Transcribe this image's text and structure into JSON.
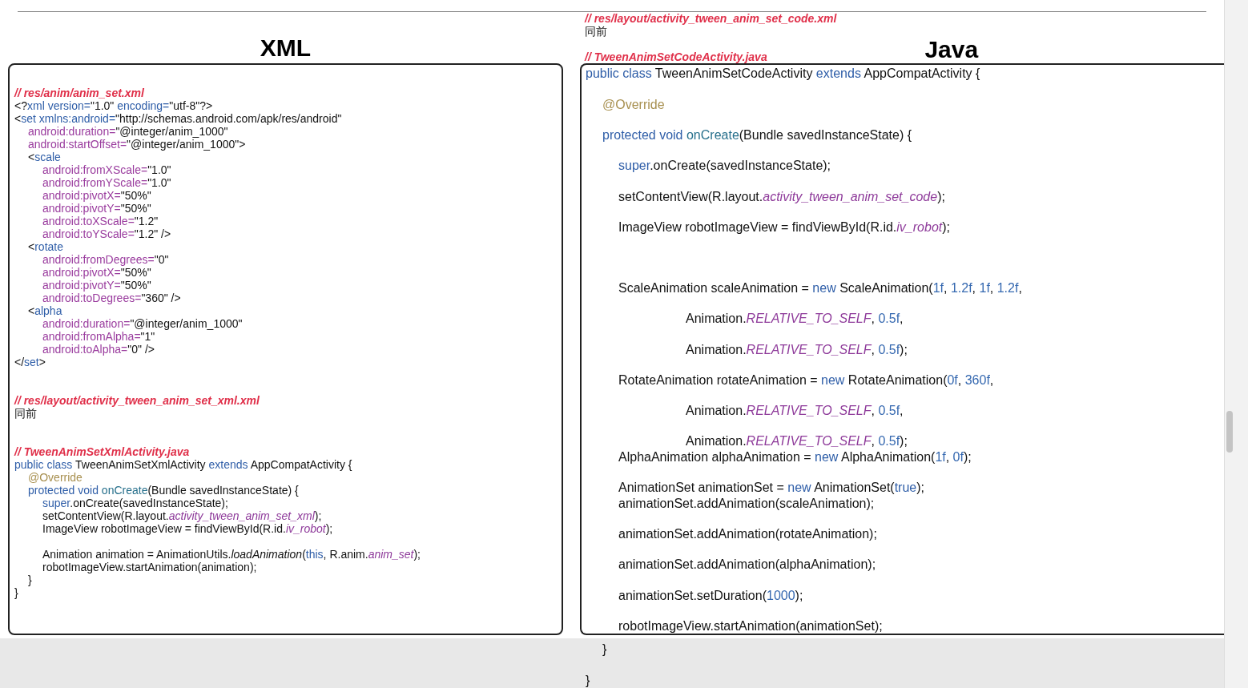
{
  "top_notes": [
    {
      "kind": "code",
      "segs": [
        {
          "kind": "cm",
          "text": "// res/layout/activity_tween_anim_set_code.xml"
        }
      ]
    },
    {
      "kind": "code",
      "segs": [
        {
          "kind": "p",
          "text": "同前"
        }
      ]
    },
    {
      "kind": "blank"
    },
    {
      "kind": "code",
      "segs": [
        {
          "kind": "cm",
          "text": "// TweenAnimSetCodeActivity.java"
        }
      ]
    }
  ],
  "panels": [
    {
      "heading": "XML",
      "kind": "dense",
      "lines": [
        {
          "kind": "code",
          "segs": [
            {
              "kind": "cm",
              "text": "// res/anim/anim_set.xml"
            }
          ]
        },
        {
          "kind": "code",
          "segs": [
            {
              "kind": "p",
              "text": "<?"
            },
            {
              "kind": "tag",
              "text": "xml version="
            },
            {
              "kind": "p",
              "text": "\"1.0\" "
            },
            {
              "kind": "tag",
              "text": "encoding="
            },
            {
              "kind": "p",
              "text": "\"utf-8\"?>"
            }
          ]
        },
        {
          "kind": "code",
          "segs": [
            {
              "kind": "p",
              "text": "<"
            },
            {
              "kind": "tag",
              "text": "set xmlns:android="
            },
            {
              "kind": "p",
              "text": "\"http://schemas.android.com/apk/res/android\""
            }
          ],
          "children": [
            {
              "kind": "code",
              "segs": [
                {
                  "kind": "attr",
                  "text": "android:duration="
                },
                {
                  "kind": "p",
                  "text": "\"@integer/anim_1000\""
                }
              ]
            },
            {
              "kind": "code",
              "segs": [
                {
                  "kind": "attr",
                  "text": "android:startOffset="
                },
                {
                  "kind": "p",
                  "text": "\"@integer/anim_1000\">"
                }
              ]
            },
            {
              "kind": "code",
              "segs": [
                {
                  "kind": "p",
                  "text": "<"
                },
                {
                  "kind": "tag",
                  "text": "scale"
                }
              ],
              "children": [
                {
                  "kind": "code",
                  "segs": [
                    {
                      "kind": "attr",
                      "text": "android:fromXScale="
                    },
                    {
                      "kind": "p",
                      "text": "\"1.0\""
                    }
                  ]
                },
                {
                  "kind": "code",
                  "segs": [
                    {
                      "kind": "attr",
                      "text": "android:fromYScale="
                    },
                    {
                      "kind": "p",
                      "text": "\"1.0\""
                    }
                  ]
                },
                {
                  "kind": "code",
                  "segs": [
                    {
                      "kind": "attr",
                      "text": "android:pivotX="
                    },
                    {
                      "kind": "p",
                      "text": "\"50%\""
                    }
                  ]
                },
                {
                  "kind": "code",
                  "segs": [
                    {
                      "kind": "attr",
                      "text": "android:pivotY="
                    },
                    {
                      "kind": "p",
                      "text": "\"50%\""
                    }
                  ]
                },
                {
                  "kind": "code",
                  "segs": [
                    {
                      "kind": "attr",
                      "text": "android:toXScale="
                    },
                    {
                      "kind": "p",
                      "text": "\"1.2\""
                    }
                  ]
                },
                {
                  "kind": "code",
                  "segs": [
                    {
                      "kind": "attr",
                      "text": "android:toYScale="
                    },
                    {
                      "kind": "p",
                      "text": "\"1.2\" />"
                    }
                  ]
                }
              ]
            },
            {
              "kind": "code",
              "segs": [
                {
                  "kind": "p",
                  "text": "<"
                },
                {
                  "kind": "tag",
                  "text": "rotate"
                }
              ],
              "children": [
                {
                  "kind": "code",
                  "segs": [
                    {
                      "kind": "attr",
                      "text": "android:fromDegrees="
                    },
                    {
                      "kind": "p",
                      "text": "\"0\""
                    }
                  ]
                },
                {
                  "kind": "code",
                  "segs": [
                    {
                      "kind": "attr",
                      "text": "android:pivotX="
                    },
                    {
                      "kind": "p",
                      "text": "\"50%\""
                    }
                  ]
                },
                {
                  "kind": "code",
                  "segs": [
                    {
                      "kind": "attr",
                      "text": "android:pivotY="
                    },
                    {
                      "kind": "p",
                      "text": "\"50%\""
                    }
                  ]
                },
                {
                  "kind": "code",
                  "segs": [
                    {
                      "kind": "attr",
                      "text": "android:toDegrees="
                    },
                    {
                      "kind": "p",
                      "text": "\"360\" />"
                    }
                  ]
                }
              ]
            },
            {
              "kind": "code",
              "segs": [
                {
                  "kind": "p",
                  "text": "<"
                },
                {
                  "kind": "tag",
                  "text": "alpha"
                }
              ],
              "children": [
                {
                  "kind": "code",
                  "segs": [
                    {
                      "kind": "attr",
                      "text": "android:duration="
                    },
                    {
                      "kind": "p",
                      "text": "\"@integer/anim_1000\""
                    }
                  ]
                },
                {
                  "kind": "code",
                  "segs": [
                    {
                      "kind": "attr",
                      "text": "android:fromAlpha="
                    },
                    {
                      "kind": "p",
                      "text": "\"1\""
                    }
                  ]
                },
                {
                  "kind": "code",
                  "segs": [
                    {
                      "kind": "attr",
                      "text": "android:toAlpha="
                    },
                    {
                      "kind": "p",
                      "text": "\"0\" />"
                    }
                  ]
                }
              ]
            }
          ]
        },
        {
          "kind": "code",
          "segs": [
            {
              "kind": "p",
              "text": "</"
            },
            {
              "kind": "tag",
              "text": "set"
            },
            {
              "kind": "p",
              "text": ">"
            }
          ]
        },
        {
          "kind": "blank"
        },
        {
          "kind": "blank"
        },
        {
          "kind": "code",
          "segs": [
            {
              "kind": "cm",
              "text": "// res/layout/activity_tween_anim_set_xml.xml"
            }
          ]
        },
        {
          "kind": "code",
          "segs": [
            {
              "kind": "p",
              "text": "同前"
            }
          ]
        },
        {
          "kind": "blank"
        },
        {
          "kind": "blank"
        },
        {
          "kind": "code",
          "segs": [
            {
              "kind": "cm",
              "text": "// TweenAnimSetXmlActivity.java"
            }
          ]
        },
        {
          "kind": "code",
          "segs": [
            {
              "kind": "kw",
              "text": "public class"
            },
            {
              "kind": "p",
              "text": " TweenAnimSetXmlActivity "
            },
            {
              "kind": "kw",
              "text": "extends"
            },
            {
              "kind": "p",
              "text": " AppCompatActivity {"
            }
          ],
          "children": [
            {
              "kind": "code",
              "segs": [
                {
                  "kind": "ann",
                  "text": "@Override"
                }
              ]
            },
            {
              "kind": "code",
              "segs": [
                {
                  "kind": "kw",
                  "text": "protected void "
                },
                {
                  "kind": "fn",
                  "text": "onCreate"
                },
                {
                  "kind": "p",
                  "text": "(Bundle savedInstanceState) {"
                }
              ],
              "children": [
                {
                  "kind": "code",
                  "segs": [
                    {
                      "kind": "kw",
                      "text": "super"
                    },
                    {
                      "kind": "p",
                      "text": ".onCreate(savedInstanceState);"
                    }
                  ]
                },
                {
                  "kind": "code",
                  "segs": [
                    {
                      "kind": "p",
                      "text": "setContentView(R.layout."
                    },
                    {
                      "kind": "it",
                      "text": "activity_tween_anim_set_xml"
                    },
                    {
                      "kind": "p",
                      "text": ");"
                    }
                  ]
                },
                {
                  "kind": "code",
                  "segs": [
                    {
                      "kind": "p",
                      "text": "ImageView robotImageView = findViewById(R.id."
                    },
                    {
                      "kind": "it",
                      "text": "iv_robot"
                    },
                    {
                      "kind": "p",
                      "text": ");"
                    }
                  ]
                },
                {
                  "kind": "blank"
                },
                {
                  "kind": "code",
                  "segs": [
                    {
                      "kind": "p",
                      "text": "Animation animation = AnimationUtils."
                    },
                    {
                      "kind": "itp",
                      "text": "loadAnimation"
                    },
                    {
                      "kind": "p",
                      "text": "("
                    },
                    {
                      "kind": "kw",
                      "text": "this"
                    },
                    {
                      "kind": "p",
                      "text": ", R.anim."
                    },
                    {
                      "kind": "it",
                      "text": "anim_set"
                    },
                    {
                      "kind": "p",
                      "text": ");"
                    }
                  ]
                },
                {
                  "kind": "code",
                  "segs": [
                    {
                      "kind": "p",
                      "text": "robotImageView.startAnimation(animation);"
                    }
                  ]
                }
              ]
            },
            {
              "kind": "code",
              "segs": [
                {
                  "kind": "p",
                  "text": "}"
                }
              ]
            }
          ]
        },
        {
          "kind": "code",
          "segs": [
            {
              "kind": "p",
              "text": "}"
            }
          ]
        }
      ]
    },
    {
      "heading": "Java",
      "kind": "spaced",
      "lines": [
        {
          "kind": "code",
          "segs": [
            {
              "kind": "kw",
              "text": "public class"
            },
            {
              "kind": "p",
              "text": " TweenAnimSetCodeActivity "
            },
            {
              "kind": "kw",
              "text": "extends"
            },
            {
              "kind": "p",
              "text": " AppCompatActivity {"
            }
          ],
          "children": [
            {
              "kind": "blank"
            },
            {
              "kind": "code",
              "segs": [
                {
                  "kind": "ann",
                  "text": "@Override"
                }
              ]
            },
            {
              "kind": "blank"
            },
            {
              "kind": "code",
              "segs": [
                {
                  "kind": "kw",
                  "text": "protected void "
                },
                {
                  "kind": "fn",
                  "text": "onCreate"
                },
                {
                  "kind": "p",
                  "text": "(Bundle savedInstanceState) {"
                }
              ],
              "children": [
                {
                  "kind": "blank"
                },
                {
                  "kind": "code",
                  "segs": [
                    {
                      "kind": "kw",
                      "text": "super"
                    },
                    {
                      "kind": "p",
                      "text": ".onCreate(savedInstanceState);"
                    }
                  ]
                },
                {
                  "kind": "blank"
                },
                {
                  "kind": "code",
                  "segs": [
                    {
                      "kind": "p",
                      "text": "setContentView(R.layout."
                    },
                    {
                      "kind": "it",
                      "text": "activity_tween_anim_set_code"
                    },
                    {
                      "kind": "p",
                      "text": ");"
                    }
                  ]
                },
                {
                  "kind": "blank"
                },
                {
                  "kind": "code",
                  "segs": [
                    {
                      "kind": "p",
                      "text": "ImageView robotImageView = findViewById(R.id."
                    },
                    {
                      "kind": "it",
                      "text": "iv_robot"
                    },
                    {
                      "kind": "p",
                      "text": ");"
                    }
                  ]
                },
                {
                  "kind": "blank"
                },
                {
                  "kind": "blank"
                },
                {
                  "kind": "blank"
                },
                {
                  "kind": "code",
                  "segs": [
                    {
                      "kind": "p",
                      "text": "ScaleAnimation scaleAnimation = "
                    },
                    {
                      "kind": "kw",
                      "text": "new"
                    },
                    {
                      "kind": "p",
                      "text": " ScaleAnimation("
                    },
                    {
                      "kind": "num",
                      "text": "1f"
                    },
                    {
                      "kind": "p",
                      "text": ", "
                    },
                    {
                      "kind": "num",
                      "text": "1.2f"
                    },
                    {
                      "kind": "p",
                      "text": ", "
                    },
                    {
                      "kind": "num",
                      "text": "1f"
                    },
                    {
                      "kind": "p",
                      "text": ", "
                    },
                    {
                      "kind": "num",
                      "text": "1.2f"
                    },
                    {
                      "kind": "p",
                      "text": ","
                    }
                  ],
                  "children": [
                    {
                      "kind": "blank"
                    },
                    {
                      "kind": "code",
                      "segs": [
                        {
                          "kind": "p",
                          "text": "Animation."
                        },
                        {
                          "kind": "it",
                          "text": "RELATIVE_TO_SELF"
                        },
                        {
                          "kind": "p",
                          "text": ", "
                        },
                        {
                          "kind": "num",
                          "text": "0.5f"
                        },
                        {
                          "kind": "p",
                          "text": ","
                        }
                      ]
                    },
                    {
                      "kind": "blank"
                    },
                    {
                      "kind": "code",
                      "segs": [
                        {
                          "kind": "p",
                          "text": "Animation."
                        },
                        {
                          "kind": "it",
                          "text": "RELATIVE_TO_SELF"
                        },
                        {
                          "kind": "p",
                          "text": ", "
                        },
                        {
                          "kind": "num",
                          "text": "0.5f"
                        },
                        {
                          "kind": "p",
                          "text": ");"
                        }
                      ]
                    }
                  ]
                },
                {
                  "kind": "blank"
                },
                {
                  "kind": "code",
                  "segs": [
                    {
                      "kind": "p",
                      "text": "RotateAnimation rotateAnimation = "
                    },
                    {
                      "kind": "kw",
                      "text": "new"
                    },
                    {
                      "kind": "p",
                      "text": " RotateAnimation("
                    },
                    {
                      "kind": "num",
                      "text": "0f"
                    },
                    {
                      "kind": "p",
                      "text": ", "
                    },
                    {
                      "kind": "num",
                      "text": "360f"
                    },
                    {
                      "kind": "p",
                      "text": ","
                    }
                  ],
                  "children": [
                    {
                      "kind": "blank"
                    },
                    {
                      "kind": "code",
                      "segs": [
                        {
                          "kind": "p",
                          "text": "Animation."
                        },
                        {
                          "kind": "it",
                          "text": "RELATIVE_TO_SELF"
                        },
                        {
                          "kind": "p",
                          "text": ", "
                        },
                        {
                          "kind": "num",
                          "text": "0.5f"
                        },
                        {
                          "kind": "p",
                          "text": ","
                        }
                      ]
                    },
                    {
                      "kind": "blank"
                    },
                    {
                      "kind": "code",
                      "segs": [
                        {
                          "kind": "p",
                          "text": "Animation."
                        },
                        {
                          "kind": "it",
                          "text": "RELATIVE_TO_SELF"
                        },
                        {
                          "kind": "p",
                          "text": ", "
                        },
                        {
                          "kind": "num",
                          "text": "0.5f"
                        },
                        {
                          "kind": "p",
                          "text": ");"
                        }
                      ]
                    }
                  ]
                },
                {
                  "kind": "code",
                  "segs": [
                    {
                      "kind": "p",
                      "text": "AlphaAnimation alphaAnimation = "
                    },
                    {
                      "kind": "kw",
                      "text": "new"
                    },
                    {
                      "kind": "p",
                      "text": " AlphaAnimation("
                    },
                    {
                      "kind": "num",
                      "text": "1f"
                    },
                    {
                      "kind": "p",
                      "text": ", "
                    },
                    {
                      "kind": "num",
                      "text": "0f"
                    },
                    {
                      "kind": "p",
                      "text": ");"
                    }
                  ]
                },
                {
                  "kind": "blank"
                },
                {
                  "kind": "code",
                  "segs": [
                    {
                      "kind": "p",
                      "text": "AnimationSet animationSet = "
                    },
                    {
                      "kind": "kw",
                      "text": "new"
                    },
                    {
                      "kind": "p",
                      "text": " AnimationSet("
                    },
                    {
                      "kind": "kw",
                      "text": "true"
                    },
                    {
                      "kind": "p",
                      "text": ");"
                    }
                  ]
                },
                {
                  "kind": "code",
                  "segs": [
                    {
                      "kind": "p",
                      "text": "animationSet.addAnimation(scaleAnimation);"
                    }
                  ]
                },
                {
                  "kind": "blank"
                },
                {
                  "kind": "code",
                  "segs": [
                    {
                      "kind": "p",
                      "text": "animationSet.addAnimation(rotateAnimation);"
                    }
                  ]
                },
                {
                  "kind": "blank"
                },
                {
                  "kind": "code",
                  "segs": [
                    {
                      "kind": "p",
                      "text": "animationSet.addAnimation(alphaAnimation);"
                    }
                  ]
                },
                {
                  "kind": "blank"
                },
                {
                  "kind": "code",
                  "segs": [
                    {
                      "kind": "p",
                      "text": "animationSet.setDuration("
                    },
                    {
                      "kind": "num",
                      "text": "1000"
                    },
                    {
                      "kind": "p",
                      "text": ");"
                    }
                  ]
                },
                {
                  "kind": "blank"
                },
                {
                  "kind": "code",
                  "segs": [
                    {
                      "kind": "p",
                      "text": "robotImageView.startAnimation(animationSet);"
                    }
                  ]
                }
              ]
            }
          ]
        }
      ]
    }
  ],
  "after_panel": [
    {
      "kind": "group",
      "children": [
        {
          "kind": "code",
          "segs": [
            {
              "kind": "p",
              "text": "}"
            }
          ]
        }
      ]
    },
    {
      "kind": "blank"
    },
    {
      "kind": "code",
      "segs": [
        {
          "kind": "p",
          "text": "}"
        }
      ]
    }
  ]
}
